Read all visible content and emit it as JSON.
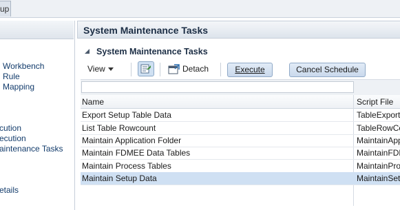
{
  "top_tab": {
    "label": "up"
  },
  "left_nav": {
    "items": [
      {
        "label": "Workbench"
      },
      {
        "label": "Rule"
      },
      {
        "label": "Mapping"
      },
      {
        "label": "cution"
      },
      {
        "label": "ecution"
      },
      {
        "label": "aintenance Tasks"
      },
      {
        "label": "etails"
      }
    ]
  },
  "main": {
    "title": "System Maintenance Tasks",
    "section_title": "System Maintenance Tasks",
    "toolbar": {
      "view_label": "View",
      "detach_label": "Detach",
      "execute_label": "Execute",
      "cancel_schedule_label": "Cancel Schedule"
    },
    "filter": {
      "value": ""
    },
    "table": {
      "columns": [
        "Name",
        "Script File"
      ],
      "rows": [
        {
          "name": "Export Setup Table Data",
          "script": "TableExportSetupData"
        },
        {
          "name": "List Table Rowcount",
          "script": "TableRowCount"
        },
        {
          "name": "Maintain Application Folder",
          "script": "MaintainApplicationFolder"
        },
        {
          "name": "Maintain FDMEE Data Tables",
          "script": "MaintainFDMEEDataTables"
        },
        {
          "name": "Maintain Process Tables",
          "script": "MaintainProcessTables"
        },
        {
          "name": "Maintain Setup Data",
          "script": "MaintainSetupData",
          "selected": true
        }
      ]
    }
  },
  "colors": {
    "accent": "#1c2e45",
    "nav_link": "#123b6b",
    "selected_row": "#cfe0f3",
    "button": "#c9d9ec"
  }
}
